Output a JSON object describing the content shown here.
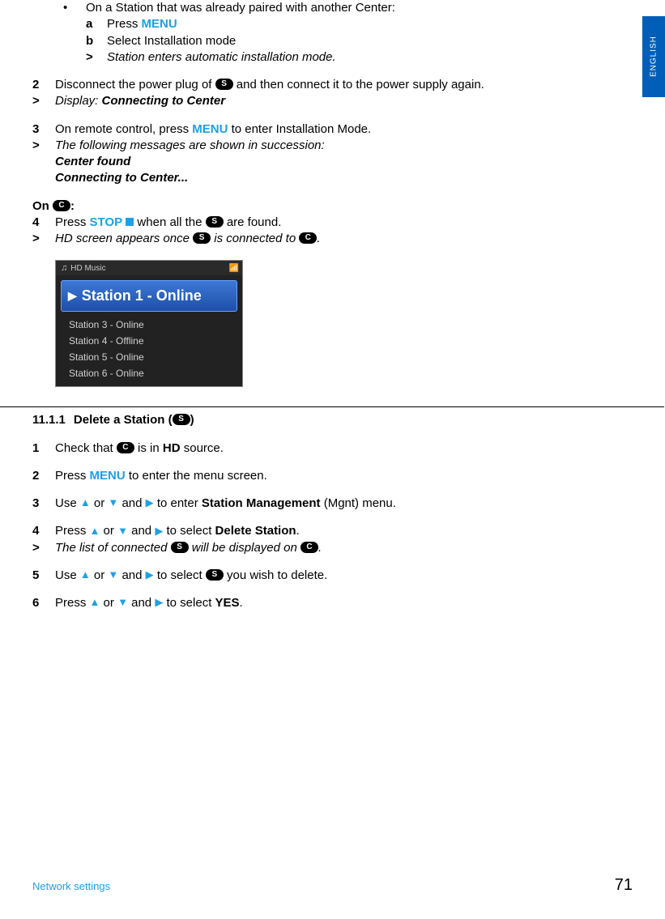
{
  "lang_tab": "ENGLISH",
  "top": {
    "bullet_text": "On a Station that was already paired with another Center:",
    "a": {
      "lead": "a",
      "pre": "Press ",
      "menu": "MENU"
    },
    "b": {
      "lead": "b",
      "text": "Select Installation mode"
    },
    "gt": {
      "lead": ">",
      "text": "Station enters automatic installation mode."
    }
  },
  "step2": {
    "lead": "2",
    "pre": "Disconnect the power plug of ",
    "chip": "S",
    "post": " and then connect it to the power supply again."
  },
  "step2r": {
    "lead": ">",
    "pre": "Display: ",
    "bold": "Connecting to Center"
  },
  "step3": {
    "lead": "3",
    "pre": "On remote control, press ",
    "menu": "MENU",
    "post": " to enter Installation Mode."
  },
  "step3r": {
    "lead": ">",
    "text": "The following messages are shown in succession:"
  },
  "step3r_l1": "Center found",
  "step3r_l2": "Connecting to Center...",
  "onC": {
    "pre": "On ",
    "chip": "C",
    "post": ":"
  },
  "step4": {
    "lead": "4",
    "pre": "Press ",
    "stop": "STOP",
    "mid": " when all the ",
    "chip": "S",
    "post": " are found."
  },
  "step4r": {
    "lead": ">",
    "pre": "HD screen appears once ",
    "chip1": "S",
    "mid": " is connected to ",
    "chip2": "C",
    "post": "."
  },
  "figure": {
    "header": "HD Music",
    "selected": "Station 1 - Online",
    "items": [
      "Station 3 - Online",
      "Station 4 - Offline",
      "Station 5 - Online",
      "Station 6 - Online"
    ]
  },
  "section": {
    "num": "11.1.1",
    "title_pre": "Delete a Station (",
    "chip": "S",
    "title_post": ")"
  },
  "d1": {
    "lead": "1",
    "pre": "Check that ",
    "chip": "C",
    "mid": " is in ",
    "bold": "HD",
    "post": " source."
  },
  "d2": {
    "lead": "2",
    "pre": "Press ",
    "menu": "MENU",
    "post": " to enter the menu screen."
  },
  "d3": {
    "lead": "3",
    "pre": "Use ",
    "mid1": " or ",
    " mid2": " and ",
    "mid3": " to enter ",
    "bold": "Station Management",
    "post": " (Mgnt) menu."
  },
  "d4": {
    "lead": "4",
    "pre": "Press ",
    "mid1": " or ",
    "mid2": " and ",
    "mid3": " to select ",
    "bold": "Delete Station",
    "post": "."
  },
  "d4r": {
    "lead": ">",
    "pre": "The list of connected ",
    "chip1": "S",
    "mid": " will be displayed on ",
    "chip2": "C",
    "post": "."
  },
  "d5": {
    "lead": "5",
    "pre": "Use ",
    "mid1": " or ",
    "mid2": " and ",
    "mid3": " to select ",
    "chip": "S",
    "post": " you wish to delete."
  },
  "d6": {
    "lead": "6",
    "pre": "Press ",
    "mid1": " or ",
    "mid2": " and ",
    "mid3": " to select ",
    "bold": "YES",
    "post": "."
  },
  "footer": {
    "left": "Network settings",
    "right": "71"
  }
}
